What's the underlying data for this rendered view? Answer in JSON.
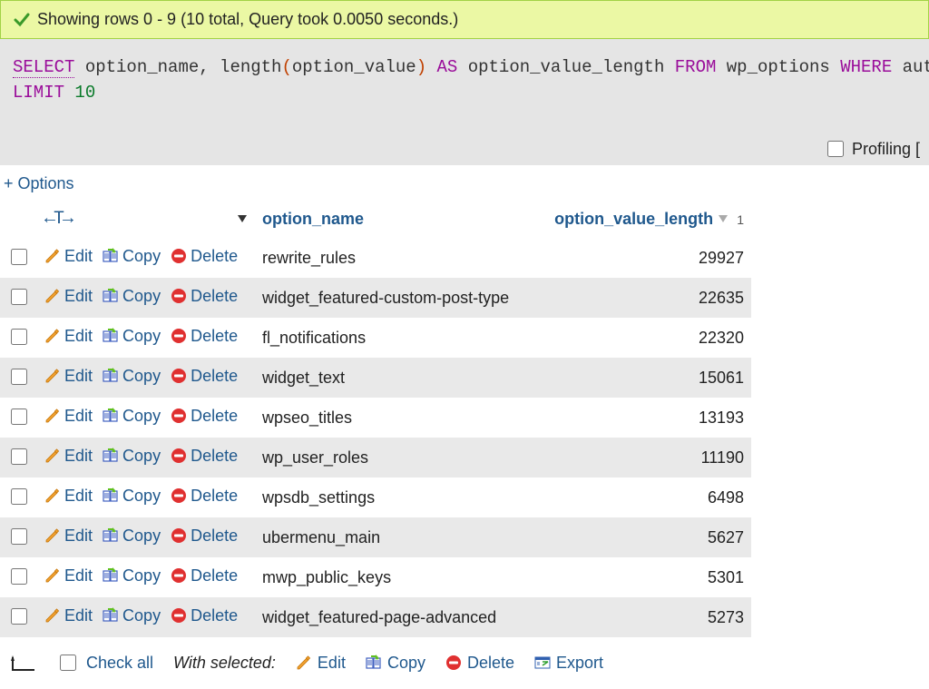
{
  "success_message": "Showing rows 0 - 9 (10 total, Query took 0.0050 seconds.)",
  "sql": {
    "select": "SELECT",
    "cols": " option_name, length",
    "paren_open": "(",
    "arg": "option_value",
    "paren_close": ")",
    "as": " AS ",
    "alias": "option_value_length",
    "from": " FROM ",
    "table": "wp_options",
    "where": " WHERE ",
    "where_tail": "auto",
    "limit": "LIMIT",
    "limit_num": " 10"
  },
  "profiling_label": "Profiling [",
  "options_link": "+ Options",
  "arrow_t": "←T→",
  "columns": {
    "option_name": "option_name",
    "option_value_length": "option_value_length",
    "sort_index": "1"
  },
  "actions": {
    "edit": "Edit",
    "copy": "Copy",
    "delete": "Delete"
  },
  "rows": [
    {
      "option_name": "rewrite_rules",
      "option_value_length": 29927
    },
    {
      "option_name": "widget_featured-custom-post-type",
      "option_value_length": 22635
    },
    {
      "option_name": "fl_notifications",
      "option_value_length": 22320
    },
    {
      "option_name": "widget_text",
      "option_value_length": 15061
    },
    {
      "option_name": "wpseo_titles",
      "option_value_length": 13193
    },
    {
      "option_name": "wp_user_roles",
      "option_value_length": 11190
    },
    {
      "option_name": "wpsdb_settings",
      "option_value_length": 6498
    },
    {
      "option_name": "ubermenu_main",
      "option_value_length": 5627
    },
    {
      "option_name": "mwp_public_keys",
      "option_value_length": 5301
    },
    {
      "option_name": "widget_featured-page-advanced",
      "option_value_length": 5273
    }
  ],
  "footer": {
    "check_all": "Check all",
    "with_selected": "With selected:",
    "edit": "Edit",
    "copy": "Copy",
    "delete": "Delete",
    "export": "Export"
  }
}
